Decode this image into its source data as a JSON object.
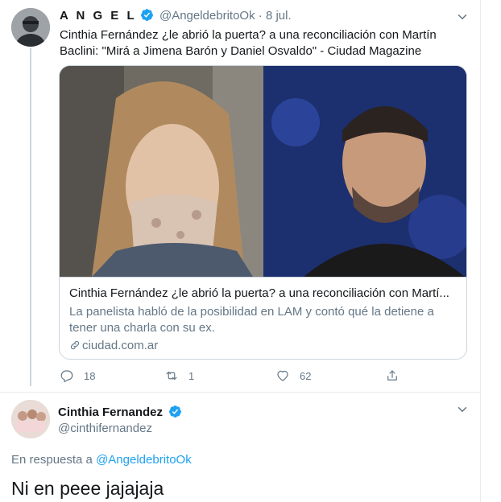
{
  "tweet1": {
    "author_name": "A N G E L",
    "handle": "@AngeldebritoOk",
    "separator": "·",
    "date": "8 jul.",
    "text": "Cinthia Fernández ¿le abrió la puerta? a una reconciliación con Martín Baclini: \"Mirá a Jimena Barón y Daniel Osvaldo\" - Ciudad Magazine",
    "card": {
      "title": "Cinthia Fernández ¿le abrió la puerta? a una reconciliación con Martí...",
      "description": "La panelista habló de la posibilidad en LAM y contó qué la detiene a tener una charla con su ex.",
      "domain": "ciudad.com.ar"
    },
    "actions": {
      "reply_count": "18",
      "retweet_count": "1",
      "like_count": "62"
    }
  },
  "tweet2": {
    "author_name": "Cinthia Fernandez",
    "handle": "@cinthifernandez",
    "reply_prefix": "En respuesta a",
    "reply_mention": "@AngeldebritoOk",
    "text": "Ni en peee jajajaja"
  },
  "colors": {
    "accent": "#1da1f2",
    "secondary_text": "#657786",
    "border": "#e6ecf0"
  }
}
